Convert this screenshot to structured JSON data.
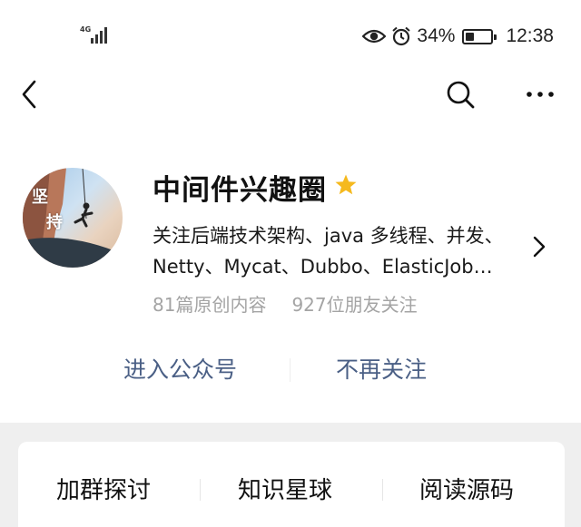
{
  "status_bar": {
    "network": "4G",
    "battery": "34%",
    "battery_level": 0.34,
    "time": "12:38",
    "icons": [
      "signal-icon",
      "eye-icon",
      "alarm-icon",
      "battery-icon"
    ]
  },
  "nav": {
    "back_icon": "chevron-left-icon",
    "search_icon": "search-icon",
    "more_icon": "more-dots-icon"
  },
  "profile": {
    "avatar_text_1": "坚",
    "avatar_text_2": "持",
    "name": "中间件兴趣圈",
    "star_icon": "star-icon",
    "star_color": "#F5B91E",
    "description_line1": "关注后端技术架构、java 多线程、并发、",
    "description_line2": "Netty、Mycat、Dubbo、ElasticJob…",
    "stats": {
      "articles": "81篇原创内容",
      "followers": "927位朋友关注"
    }
  },
  "actions": {
    "enter": "进入公众号",
    "unfollow": "不再关注",
    "link_color": "#4A5F85"
  },
  "menu": {
    "items": [
      "加群探讨",
      "知识星球",
      "阅读源码"
    ]
  }
}
